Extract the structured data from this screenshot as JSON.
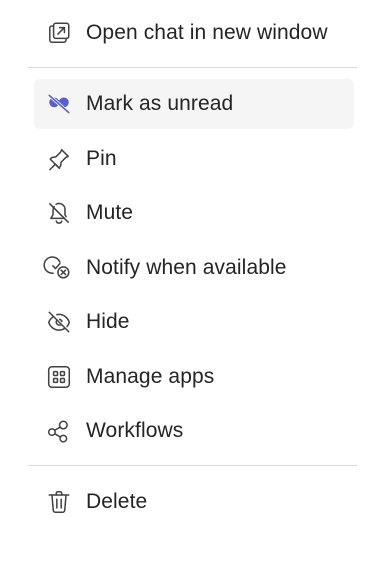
{
  "menu": {
    "items": [
      {
        "label": "Open chat in new window",
        "icon": "open-in-new-window-icon"
      },
      {
        "label": "Mark as unread",
        "icon": "mark-unread-icon"
      },
      {
        "label": "Pin",
        "icon": "pin-icon"
      },
      {
        "label": "Mute",
        "icon": "mute-bell-icon"
      },
      {
        "label": "Notify when available",
        "icon": "notify-available-icon"
      },
      {
        "label": "Hide",
        "icon": "hide-eye-icon"
      },
      {
        "label": "Manage apps",
        "icon": "apps-grid-icon"
      },
      {
        "label": "Workflows",
        "icon": "workflows-icon"
      },
      {
        "label": "Delete",
        "icon": "trash-icon"
      }
    ],
    "hovered_item": "Mark as unread",
    "colors": {
      "text": "#242424",
      "icon": "#424242",
      "accent": "#5b5fc7",
      "hover_bg": "#f5f5f5",
      "divider": "#d9d9d9"
    }
  }
}
